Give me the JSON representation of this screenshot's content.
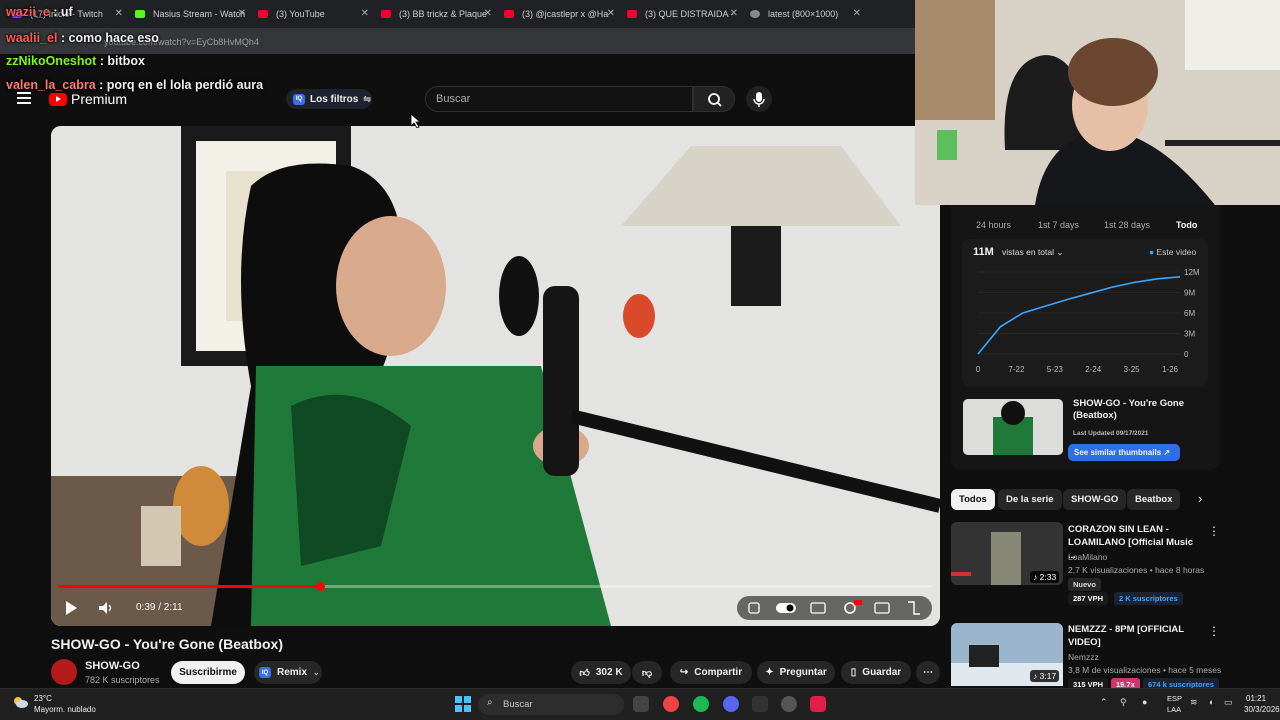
{
  "browser": {
    "tabs": [
      {
        "label": "(17) Inicio - Twitch",
        "favicon": "twitch-icon"
      },
      {
        "label": "Nasius Stream - Watch",
        "favicon": "kick-icon"
      },
      {
        "label": "(3) YouTube",
        "favicon": "youtube-icon"
      },
      {
        "label": "(3) BB trickz & Plaque",
        "favicon": "youtube-icon"
      },
      {
        "label": "(3) @jcastlepr x @Ha",
        "favicon": "youtube-icon"
      },
      {
        "label": "(3) QUE DISTRAIDA -",
        "favicon": "youtube-icon"
      },
      {
        "label": "latest (800×1000)",
        "favicon": "globe-icon"
      }
    ],
    "url": "youtube.com/watch?v=EyCb8HvMQh4"
  },
  "chat": [
    {
      "user": "wazii_e",
      "message": "uf"
    },
    {
      "user": "waalii_el",
      "message": "como hace eso"
    },
    {
      "user": "zzNikoOneshot",
      "message": "bitbox"
    },
    {
      "user": "valen_la_cabra",
      "message": "porq en el lola perdió aura"
    }
  ],
  "youtube": {
    "logo_label": "Premium",
    "filters_label": "Los filtros",
    "search_placeholder": "Buscar",
    "video": {
      "time": "0:39 / 2:11",
      "progress_fraction": 0.3,
      "title": "SHOW-GO - You're Gone (Beatbox)",
      "channel": "SHOW-GO",
      "subscribers": "782 K suscriptores",
      "subscribe_label": "Suscribirme",
      "remix_label": "Remix",
      "likes": "302 K",
      "share_label": "Compartir",
      "ask_label": "Preguntar",
      "save_label": "Guardar"
    },
    "stats_panel": {
      "ranges": [
        "24 hours",
        "1st 7 days",
        "1st 28 days",
        "Todo"
      ],
      "active_range": "Todo",
      "views": "11M",
      "views_dropdown": "vistas en total",
      "legend": "Este video",
      "chart_data": {
        "type": "line",
        "x_ticks": [
          "0",
          "7-22",
          "5-23",
          "2-24",
          "3-25",
          "1-26"
        ],
        "y_ticks": [
          "0",
          "3M",
          "6M",
          "9M",
          "12M"
        ],
        "ylim": [
          0,
          12000000
        ],
        "series": [
          {
            "name": "Este video",
            "values": [
              0,
              4000000,
              6000000,
              7000000,
              8000000,
              8900000,
              9800000,
              10500000,
              11000000,
              11300000
            ]
          }
        ]
      },
      "thumb_title": "SHOW-GO - You're Gone (Beatbox)",
      "last_updated": "Last Updated 09/17/2021",
      "similar_button": "See similar thumbnails"
    },
    "chips": [
      "Todos",
      "De la serie",
      "SHOW-GO",
      "Beatbox"
    ],
    "related": [
      {
        "title": "CORAZON SIN LEAN - LOAMILANO [Official Music ...",
        "channel": "LoaMilano",
        "meta": "2,7 K visualizaciones • hace 8 horas",
        "badge": "Nuevo",
        "duration": "2:33",
        "vph": "287 VPH",
        "subs": "2 K suscriptores"
      },
      {
        "title": "NEMZZZ - 8PM [OFFICIAL VIDEO]",
        "channel": "Nemzzz",
        "meta": "3,8 M de visualizaciones • hace 5 meses",
        "duration": "3:17",
        "vph": "315 VPH",
        "ratio": "19.7x",
        "subs": "674 k suscriptores"
      }
    ]
  },
  "taskbar": {
    "weather_temp": "23°C",
    "weather_desc": "Mayorm. nublado",
    "search_label": "Buscar",
    "lang1": "ESP",
    "lang2": "LAA",
    "time": "01:21",
    "date": "30/3/2026"
  },
  "colors": {
    "accent_red": "#ff0000",
    "link_blue": "#3ea6ff",
    "button_blue": "#2f6fe6"
  }
}
